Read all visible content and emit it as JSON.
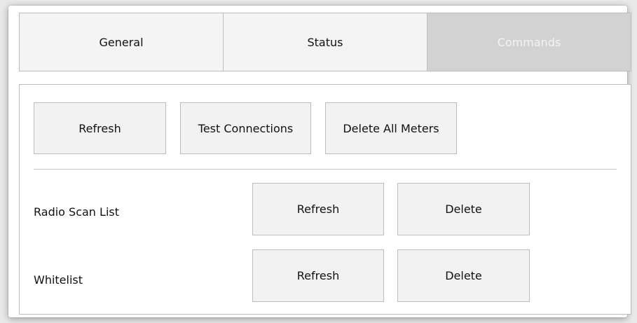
{
  "tabs": [
    {
      "label": "General",
      "active": false
    },
    {
      "label": "Status",
      "active": false
    },
    {
      "label": "Commands",
      "active": true
    }
  ],
  "commands": {
    "refresh_label": "Refresh",
    "test_connections_label": "Test Connections",
    "delete_all_meters_label": "Delete All Meters"
  },
  "lists": [
    {
      "label": "Radio Scan List",
      "refresh_label": "Refresh",
      "delete_label": "Delete"
    },
    {
      "label": "Whitelist",
      "refresh_label": "Refresh",
      "delete_label": "Delete"
    }
  ],
  "colors": {
    "active_tab_bg": "#d2d2d2",
    "button_bg": "#f2f2f2",
    "border": "#bdbdbd"
  }
}
